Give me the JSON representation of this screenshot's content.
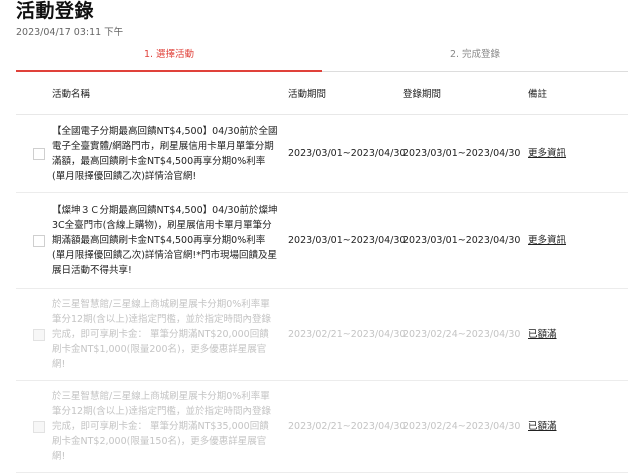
{
  "page": {
    "title": "活動登錄",
    "timestamp": "2023/04/17 03:11 下午"
  },
  "steps": [
    {
      "label": "1. 選擇活動"
    },
    {
      "label": "2. 完成登錄"
    }
  ],
  "table": {
    "headers": {
      "name": "活動名稱",
      "event_period": "活動期間",
      "register_period": "登錄期間",
      "note": "備註"
    },
    "rows": [
      {
        "name": "【全國電子分期最高回饋NT$4,500】04/30前於全國電子全臺實體/網路門市，刷星展信用卡單月單筆分期滿額，最高回饋刷卡金NT$4,500再享分期0%利率(單月限擇優回饋乙次)詳情洽官網!",
        "event_period": "2023/03/01~2023/04/30",
        "register_period": "2023/03/01~2023/04/30",
        "note": "更多資訊"
      },
      {
        "name": "【燦坤３Ｃ分期最高回饋NT$4,500】04/30前於燦坤3C全臺門市(含線上購物)，刷星展信用卡單月單筆分期滿額最高回饋刷卡金NT$4,500再享分期0%利率(單月限擇優回饋乙次)詳情洽官網!*門市現場回饋及星展日活動不得共享!",
        "event_period": "2023/03/01~2023/04/30",
        "register_period": "2023/03/01~2023/04/30",
        "note": "更多資訊"
      },
      {
        "name": "於三星智慧館/三星線上商城刷星展卡分期0%利率單筆分12期(含以上)達指定門檻，並於指定時間內登錄完成，即可享刷卡金： 單筆分期滿NT$20,000回饋刷卡金NT$1,000(限量200名)，更多優惠詳星展官網!",
        "event_period": "2023/02/21~2023/04/30",
        "register_period": "2023/02/24~2023/04/30",
        "note": "已額滿"
      },
      {
        "name": "於三星智慧館/三星線上商城刷星展卡分期0%利率單筆分12期(含以上)達指定門檻，並於指定時間內登錄完成，即可享刷卡金： 單筆分期滿NT$35,000回饋刷卡金NT$2,000(限量150名)，更多優惠詳星展官網!",
        "event_period": "2023/02/21~2023/04/30",
        "register_period": "2023/02/24~2023/04/30",
        "note": "已額滿"
      }
    ]
  }
}
